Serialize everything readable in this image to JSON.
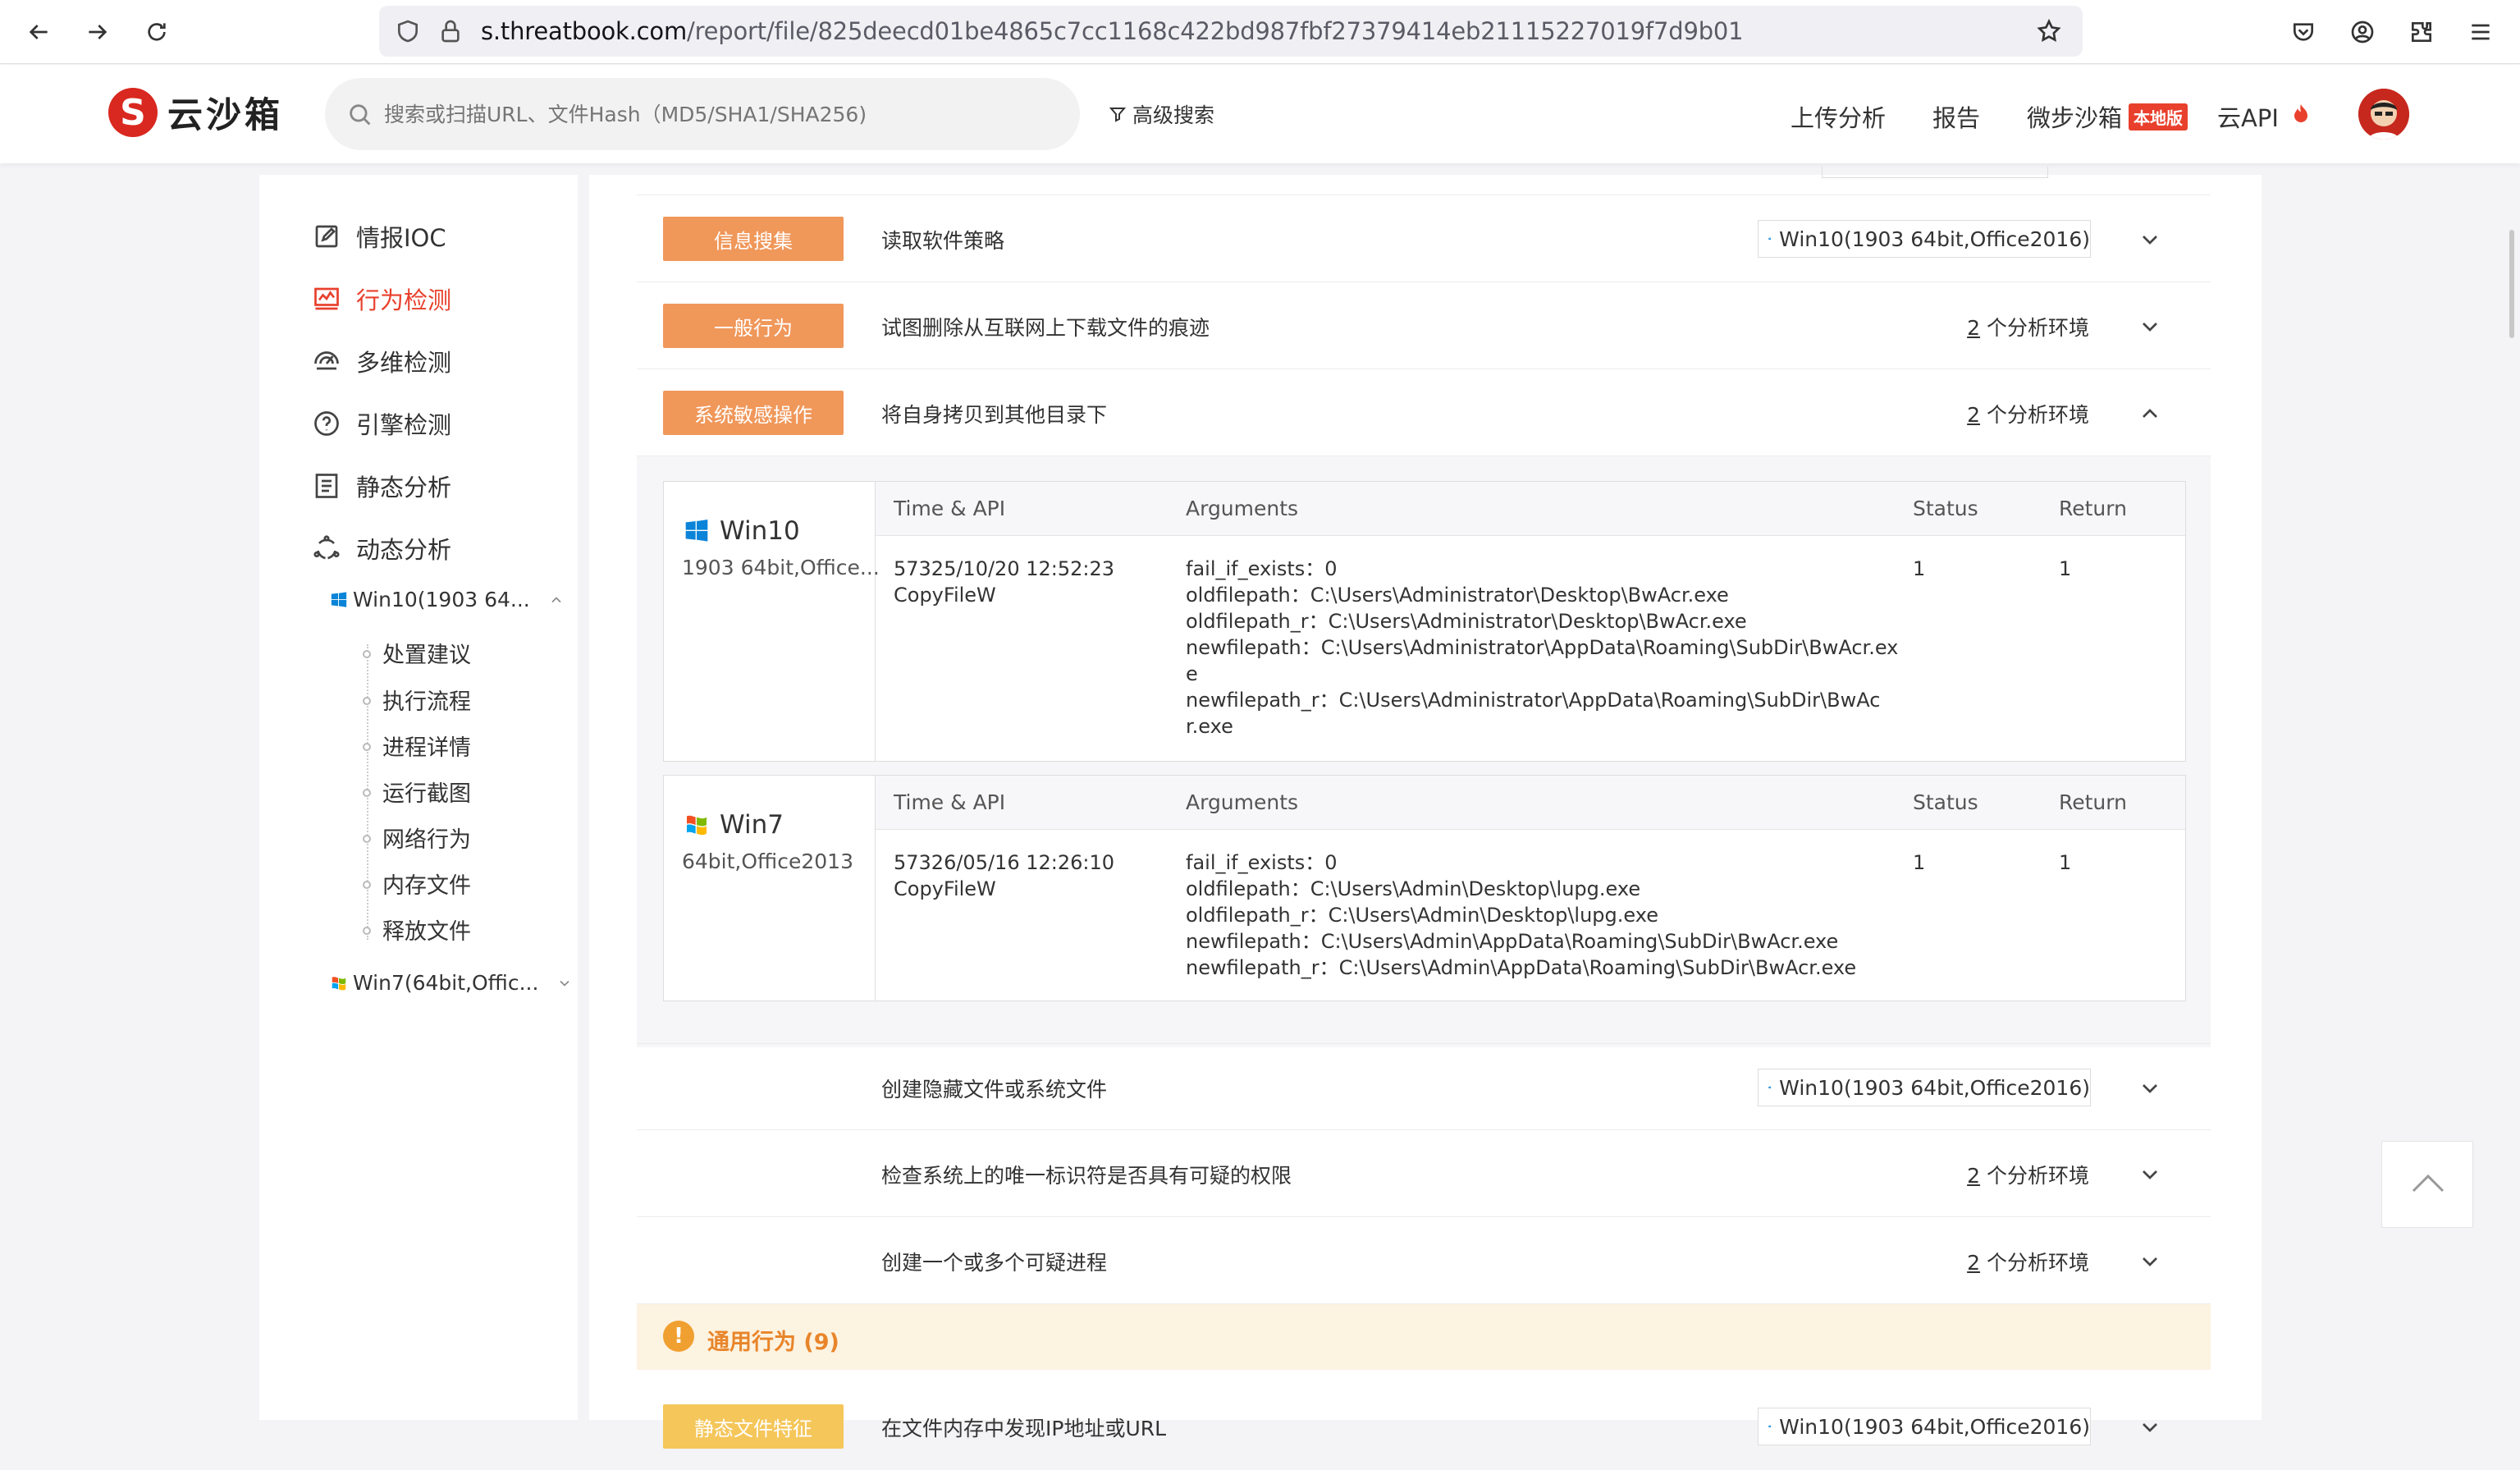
{
  "browser": {
    "url_host": "s.threatbook.com",
    "url_path": "/report/file/825deecd01be4865c7cc1168c422bd987fbf27379414eb21115227019f7d9b01"
  },
  "header": {
    "logo_mark": "S",
    "logo_text": "云沙箱",
    "search_placeholder": "搜索或扫描URL、文件Hash（MD5/SHA1/SHA256)",
    "advanced_search": "高级搜索",
    "nav": {
      "upload": "上传分析",
      "report": "报告",
      "micro": "微步沙箱",
      "micro_badge": "本地版",
      "api": "云API"
    }
  },
  "sidebar": {
    "items": [
      {
        "label": "情报IOC",
        "icon": "edit-icon"
      },
      {
        "label": "行为检测",
        "icon": "chart-icon",
        "active": true
      },
      {
        "label": "多维检测",
        "icon": "radar-icon"
      },
      {
        "label": "引擎检测",
        "icon": "question-circle-icon"
      },
      {
        "label": "静态分析",
        "icon": "document-icon"
      },
      {
        "label": "动态分析",
        "icon": "cycle-icon"
      }
    ],
    "env1": "Win10(1903 64...",
    "subitems": [
      "处置建议",
      "执行流程",
      "进程详情",
      "运行截图",
      "网络行为",
      "内存文件",
      "释放文件"
    ],
    "env2": "Win7(64bit,Offic..."
  },
  "main": {
    "rows": [
      {
        "tag": "信息搜集",
        "text": "读取软件策略",
        "env": "Win10(1903 64bit,Office2016)"
      },
      {
        "tag": "一般行为",
        "text": "试图删除从互联网上下载文件的痕迹",
        "env_count": "2",
        "env_suffix": " 个分析环境"
      },
      {
        "tag": "系统敏感操作",
        "text": "将自身拷贝到其他目录下",
        "env_count": "2",
        "env_suffix": " 个分析环境"
      }
    ],
    "table_headers": {
      "time_api": "Time & API",
      "arguments": "Arguments",
      "status": "Status",
      "return": "Return"
    },
    "boxes": [
      {
        "os": "Win10",
        "ver": "1903 64bit,Office...",
        "time": "57325/10/20 12:52:23",
        "api": "CopyFileW",
        "args": [
          "fail_if_exists：0",
          "oldfilepath：C:\\Users\\Administrator\\Desktop\\BwAcr.exe",
          "oldfilepath_r：C:\\Users\\Administrator\\Desktop\\BwAcr.exe",
          "newfilepath：C:\\Users\\Administrator\\AppData\\Roaming\\SubDir\\BwAcr.ex",
          "e",
          "newfilepath_r：C:\\Users\\Administrator\\AppData\\Roaming\\SubDir\\BwAc",
          "r.exe"
        ],
        "status": "1",
        "return": "1"
      },
      {
        "os": "Win7",
        "ver": "64bit,Office2013",
        "time": "57326/05/16 12:26:10",
        "api": "CopyFileW",
        "args": [
          "fail_if_exists：0",
          "oldfilepath：C:\\Users\\Admin\\Desktop\\lupg.exe",
          "oldfilepath_r：C:\\Users\\Admin\\Desktop\\lupg.exe",
          "newfilepath：C:\\Users\\Admin\\AppData\\Roaming\\SubDir\\BwAcr.exe",
          "newfilepath_r：C:\\Users\\Admin\\AppData\\Roaming\\SubDir\\BwAcr.exe"
        ],
        "status": "1",
        "return": "1"
      }
    ],
    "rows2": [
      {
        "text": "创建隐藏文件或系统文件",
        "env": "Win10(1903 64bit,Office2016)"
      },
      {
        "text": "检查系统上的唯一标识符是否具有可疑的权限",
        "env_count": "2",
        "env_suffix": " 个分析环境"
      },
      {
        "text": "创建一个或多个可疑进程",
        "env_count": "2",
        "env_suffix": " 个分析环境"
      }
    ],
    "section": {
      "title": "通用行为 (9)",
      "icon": "!"
    },
    "last_row": {
      "tag": "静态文件特征",
      "text": "在文件内存中发现IP地址或URL",
      "env": "Win10(1903 64bit,Office2016)"
    }
  },
  "colors": {
    "accent": "#e8402c",
    "tag_orange": "#f0975a",
    "tag_yellow": "#f5c65a",
    "section_bg": "#fdf3e1"
  }
}
